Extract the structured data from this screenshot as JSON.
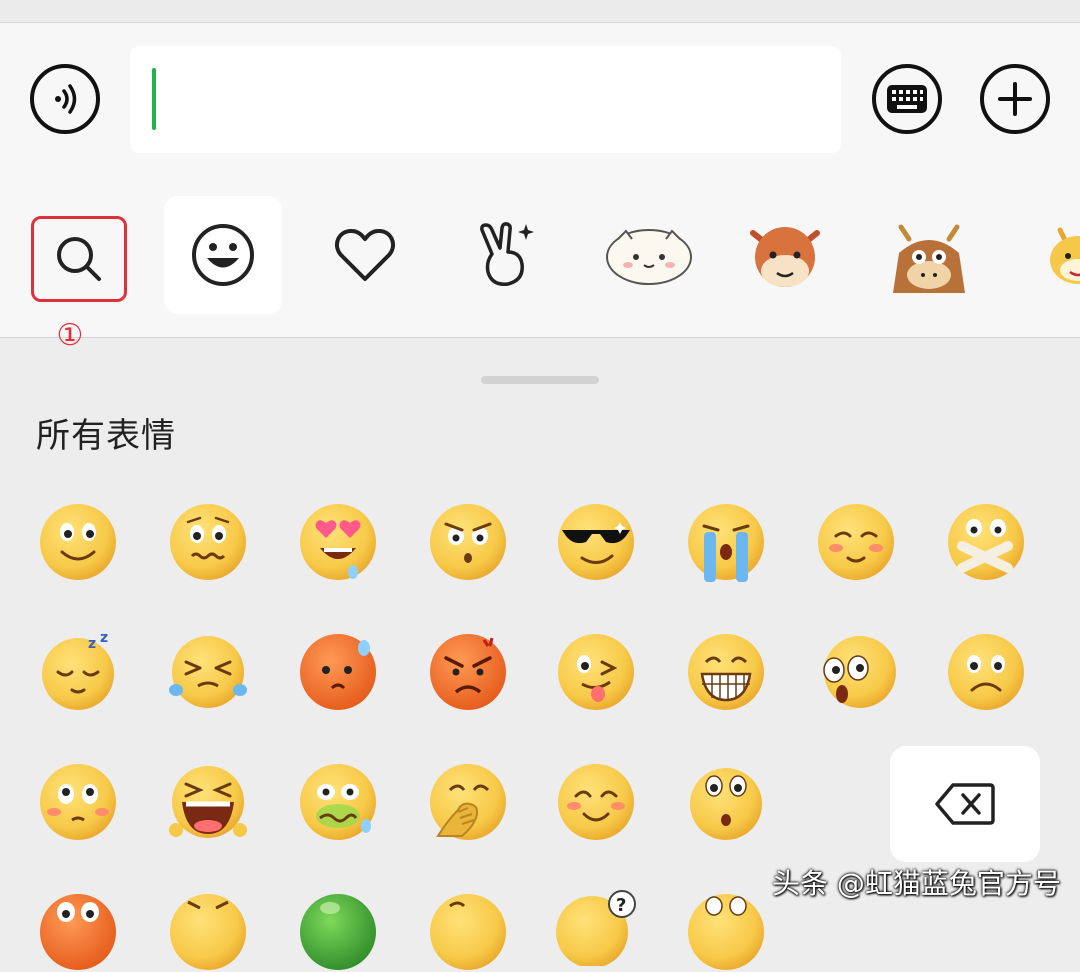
{
  "input_bar": {
    "voice_icon": "voice-icon",
    "keyboard_icon": "keyboard-icon",
    "plus_icon": "plus-icon",
    "message_value": ""
  },
  "sticker_tabs": [
    {
      "name": "search",
      "icon": "search-icon",
      "highlighted": true
    },
    {
      "name": "emoji",
      "icon": "smiley-icon",
      "selected": true
    },
    {
      "name": "favorites",
      "icon": "heart-icon"
    },
    {
      "name": "gestures",
      "icon": "victory-hand-icon"
    },
    {
      "name": "pack-1",
      "icon": "bun-character-icon"
    },
    {
      "name": "pack-2",
      "icon": "cow-face-icon"
    },
    {
      "name": "pack-3",
      "icon": "cow-character-icon"
    },
    {
      "name": "pack-4",
      "icon": "cow-mascot-icon"
    }
  ],
  "annotation": {
    "marker": "①",
    "color": "#e0303a"
  },
  "panel": {
    "section_title": "所有表情"
  },
  "emoji_grid": [
    [
      "smile",
      "awkward",
      "heart-eyes",
      "angry-stare",
      "cool-sunglasses",
      "crying-tears",
      "shy-blush",
      "mouth-shut"
    ],
    [
      "sleepy",
      "laugh-cry",
      "sweat-red",
      "furious",
      "tongue-wink",
      "grin-teeth",
      "shocked",
      "frown"
    ],
    [
      "blush-wide-eyes",
      "big-laugh",
      "sick-green",
      "facepalm",
      "happy-smile",
      "surprised"
    ],
    [
      "peek-partial",
      "peek-partial",
      "green-ball",
      "peek-partial",
      "confused-question",
      "peek-partial"
    ]
  ],
  "delete_key": {
    "icon": "backspace-icon"
  },
  "watermark": "头条 @虹猫蓝兔官方号",
  "colors": {
    "accent_green": "#22b14c",
    "highlight_red": "#e0303a",
    "emoji_yellow": "#f7c948"
  }
}
